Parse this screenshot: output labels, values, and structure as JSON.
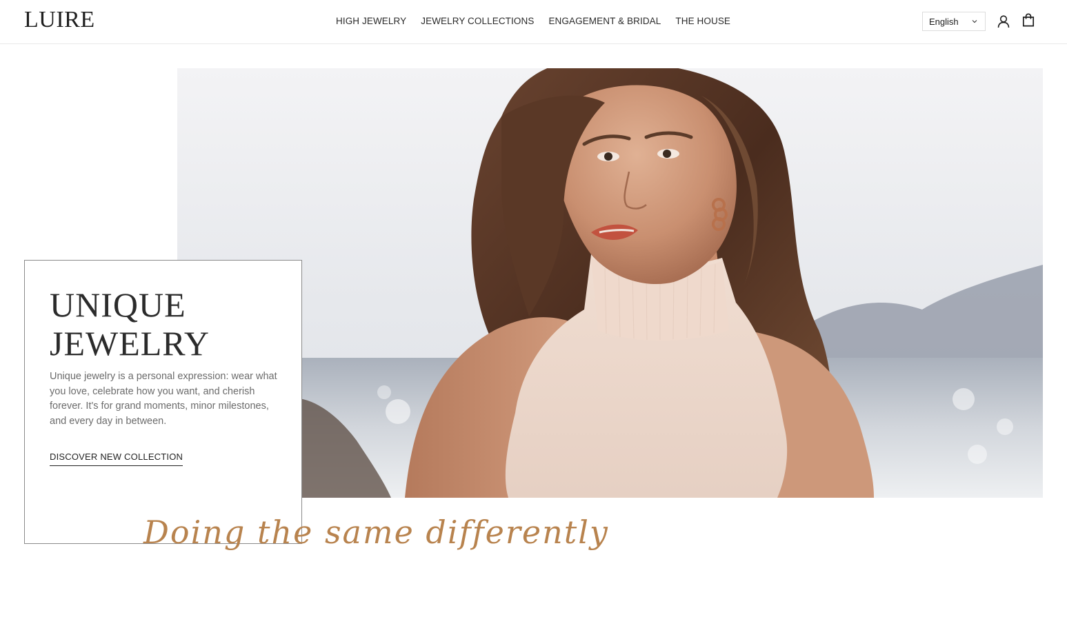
{
  "header": {
    "logo": "LUIRE",
    "nav": [
      {
        "label": "HIGH JEWELRY"
      },
      {
        "label": "JEWELRY COLLECTIONS"
      },
      {
        "label": "ENGAGEMENT & BRIDAL"
      },
      {
        "label": "THE HOUSE"
      }
    ],
    "language": {
      "selected": "English"
    },
    "icons": [
      "user-account-icon",
      "shopping-bag-icon",
      "chevron-down-icon"
    ]
  },
  "hero": {
    "title_line1": "UNIQUE",
    "title_line2": "JEWELRY",
    "description": "Unique jewelry is a personal expression: wear what you love, celebrate how you want, and cherish forever. It's for grand moments, minor milestones, and every day in between.",
    "cta": "DISCOVER NEW COLLECTION",
    "tagline": "Doing the same differently",
    "tagline_color": "#b8834e"
  },
  "colors": {
    "text": "#1c1c1c",
    "muted_text": "#6b6b6b",
    "accent": "#b8834e",
    "border": "#e9e9e9"
  }
}
